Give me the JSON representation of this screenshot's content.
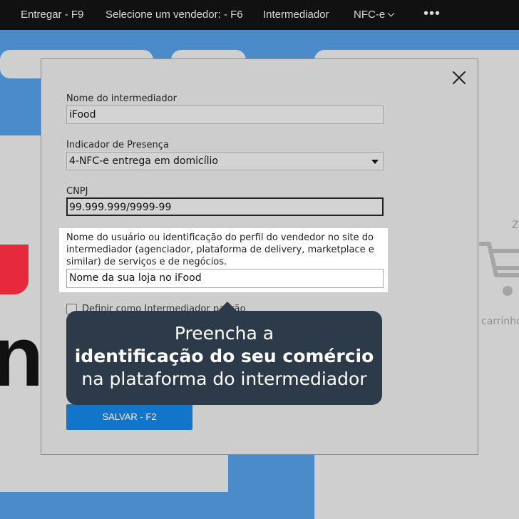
{
  "nav": {
    "deliver": "Entregar - F9",
    "seller": "Selecione um vendedor: - F6",
    "intermediary": "Intermediador",
    "nfce": "NFC-e",
    "more": "•••"
  },
  "background": {
    "cart_text": "carrinho",
    "corner_text": "Z",
    "brand_text": "ne"
  },
  "modal": {
    "intermediary_name": {
      "label": "Nome do intermediador",
      "value": "iFood"
    },
    "presence_indicator": {
      "label": "Indicador de Presença",
      "value": "4-NFC-e entrega em domicílio"
    },
    "cnpj": {
      "label": "CNPJ",
      "value": "99.999.999/9999-99"
    },
    "seller_profile": {
      "label": "Nome do usuário ou identificação do perfil do vendedor no site do intermediador (agenciador, plataforma de delivery, marketplace e similar) de serviços e de negócios.",
      "value": "Nome da sua loja no iFood"
    },
    "default_checkbox_label": "Definir como Intermediador padrão",
    "save_label": "SALVAR - F2"
  },
  "tooltip": {
    "line1": "Preencha a",
    "line2": "identificação do seu comércio",
    "line3": "na plataforma do intermediador"
  },
  "colors": {
    "topbar": "#111111",
    "accent_blue": "#1275c9",
    "tooltip_bg": "#2d3a49",
    "brand_red": "#e62a3c"
  }
}
